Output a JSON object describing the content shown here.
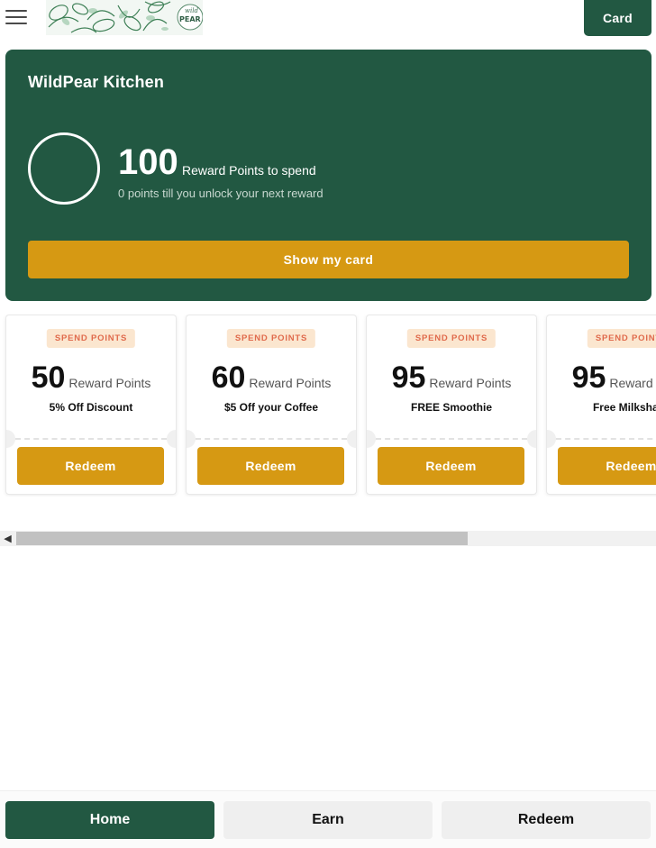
{
  "header": {
    "logo_text": "wild PEAR",
    "card_label": "Card"
  },
  "hero": {
    "title": "WildPear Kitchen",
    "points": "100",
    "points_label": "Reward Points to spend",
    "progress_text": "0 points till you unlock your next reward",
    "progress_fraction": 0,
    "show_card_label": "Show my card"
  },
  "rewards": [
    {
      "badge": "SPEND POINTS",
      "points": "50",
      "points_label": "Reward Points",
      "name": "5% Off Discount",
      "button": "Redeem"
    },
    {
      "badge": "SPEND POINTS",
      "points": "60",
      "points_label": "Reward Points",
      "name": "$5 Off your Coffee",
      "button": "Redeem"
    },
    {
      "badge": "SPEND POINTS",
      "points": "95",
      "points_label": "Reward Points",
      "name": "FREE Smoothie",
      "button": "Redeem"
    },
    {
      "badge": "SPEND POINTS",
      "points": "95",
      "points_label": "Reward Points",
      "name": "Free Milkshake",
      "button": "Redeem"
    }
  ],
  "bottom_nav": {
    "home": "Home",
    "earn": "Earn",
    "redeem": "Redeem"
  },
  "colors": {
    "brand_green": "#225842",
    "accent_gold": "#d69913",
    "badge_bg": "#fbe6cf",
    "badge_text": "#e06a4c"
  },
  "icons": {
    "menu": "hamburger-menu-icon",
    "scroll_left": "chevron-left-icon"
  }
}
